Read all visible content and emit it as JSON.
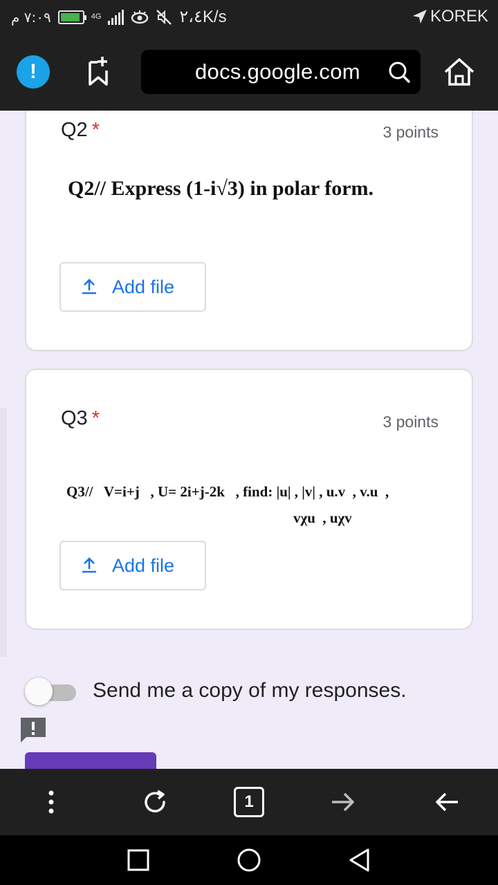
{
  "status_bar": {
    "time": "٧:٠٩ م",
    "network_speed": "٢،٤K/s",
    "network_label": "4G",
    "carrier": "KOREK"
  },
  "browser": {
    "url": "docs.google.com",
    "tab_count": "1"
  },
  "form": {
    "questions": [
      {
        "label": "Q2",
        "required_mark": "*",
        "points": "3 points",
        "image_text": [
          "Q2//   Express (1-i√3) in polar form."
        ],
        "add_file_label": "Add file"
      },
      {
        "label": "Q3",
        "required_mark": "*",
        "points": "3 points",
        "image_text": [
          "Q3//   V=i+j   , U= 2i+j-2k   , find: |u| , |v| , u.v  , v.u  ,",
          "vχu  , uχv"
        ],
        "add_file_label": "Add file"
      }
    ],
    "copy_responses_label": "Send me a copy of my responses.",
    "copy_responses_on": false
  },
  "colors": {
    "accent": "#673ab7",
    "link_blue": "#1a73e8",
    "required_red": "#d93025",
    "warn_blue": "#1aa3e8",
    "page_bg": "#f0ebf8"
  },
  "icons": {
    "browser_bar": [
      "warning-icon",
      "bookmark-add-icon",
      "search-icon",
      "home-icon"
    ],
    "toolbar": [
      "more-vert-icon",
      "reload-icon",
      "tabs-icon",
      "forward-icon",
      "back-icon"
    ],
    "nav": [
      "recents-icon",
      "home-circle-icon",
      "back-triangle-icon"
    ]
  }
}
